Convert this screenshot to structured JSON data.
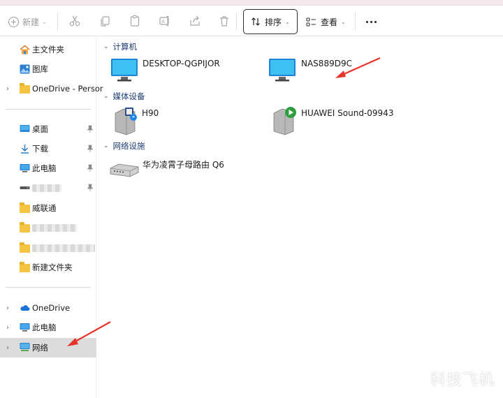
{
  "toolbar": {
    "new_label": "新建",
    "sort_label": "排序",
    "view_label": "查看",
    "icons": [
      "cut-icon",
      "copy-icon",
      "paste-icon",
      "rename-icon",
      "share-icon",
      "delete-icon"
    ]
  },
  "sidebar": {
    "quick": [
      {
        "label": "主文件夹"
      },
      {
        "label": "图库"
      },
      {
        "label": "OneDrive - Persor"
      }
    ],
    "pinned": [
      {
        "label": "桌面"
      },
      {
        "label": "下载"
      },
      {
        "label": "此电脑"
      },
      {
        "label": "威联通"
      },
      {
        "label": "新建文件夹"
      }
    ],
    "bottom": [
      {
        "label": "OneDrive"
      },
      {
        "label": "此电脑"
      },
      {
        "label": "网络"
      }
    ]
  },
  "content": {
    "groups": [
      {
        "label": "计算机",
        "items": [
          {
            "label": "DESKTOP-QGPIJOR"
          },
          {
            "label": "NAS889D9C"
          }
        ]
      },
      {
        "label": "媒体设备",
        "items": [
          {
            "label": "H90"
          },
          {
            "label": "HUAWEI Sound-09943"
          }
        ]
      },
      {
        "label": "网络设施",
        "items": [
          {
            "label": "华为凌霄子母路由 Q6"
          }
        ]
      }
    ]
  },
  "watermark": "科技飞机",
  "colors": {
    "accent": "#e6332a",
    "header_text": "#1d3b73",
    "active_bg": "#dcdcdc"
  }
}
